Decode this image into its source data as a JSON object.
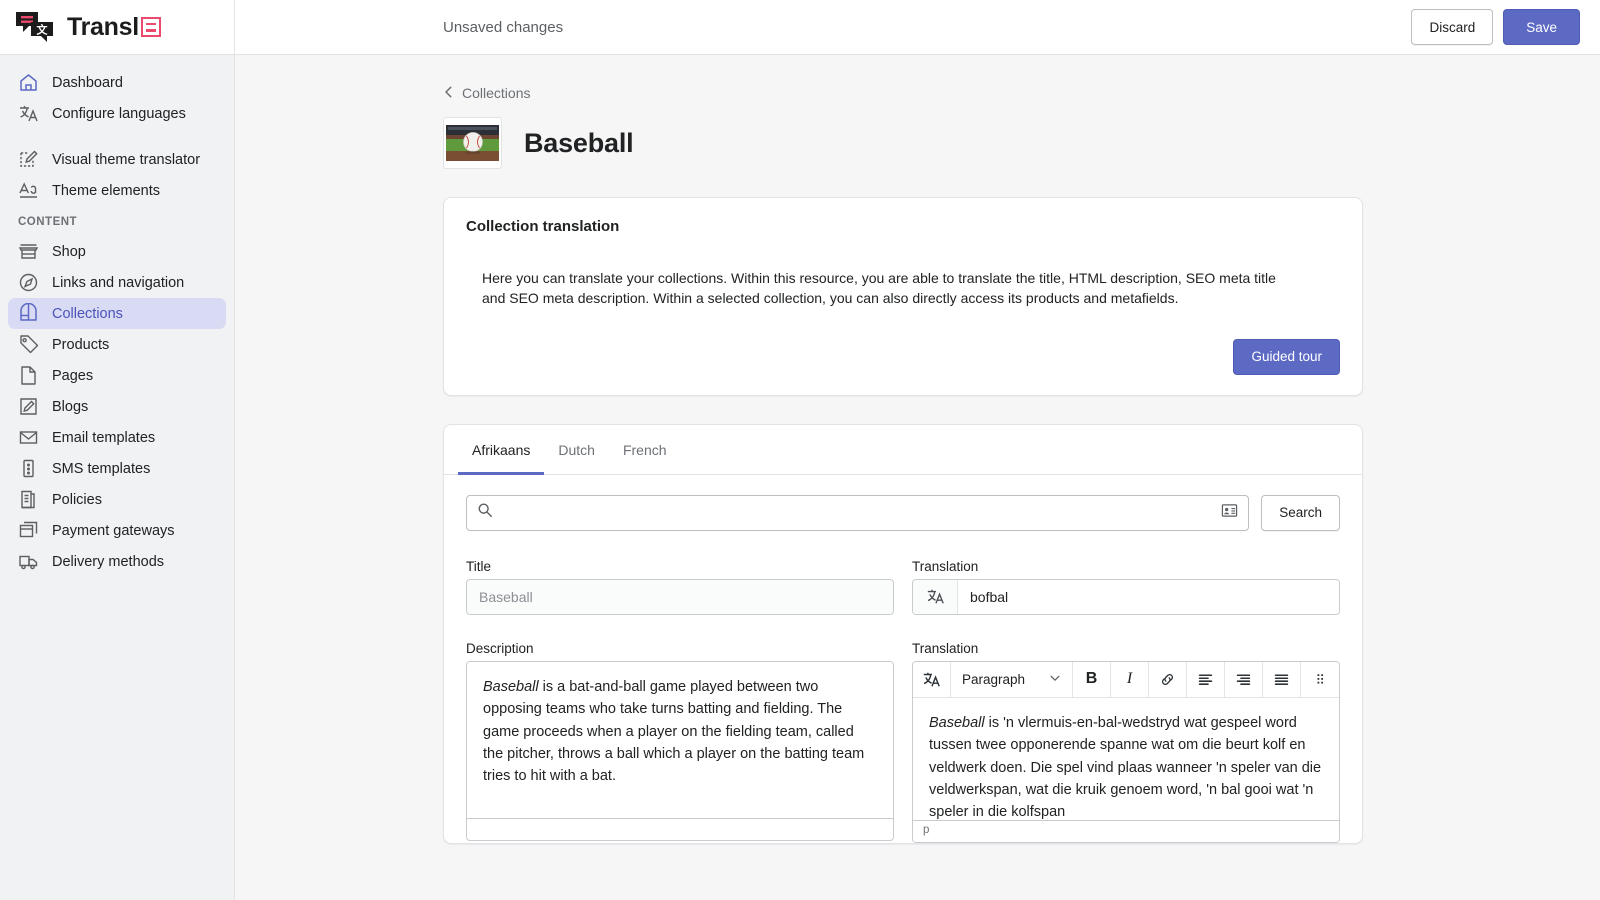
{
  "brand": {
    "name": "Transl",
    "mark_icon": "brand-square-icon"
  },
  "sidebar": {
    "items": [
      {
        "label": "Dashboard",
        "icon": "home-icon",
        "active": false
      },
      {
        "label": "Configure languages",
        "icon": "translate-icon",
        "active": false
      },
      {
        "label": "Visual theme translator",
        "icon": "theme-edit-icon",
        "active": false
      },
      {
        "label": "Theme elements",
        "icon": "text-format-icon",
        "active": false
      }
    ],
    "section_label": "CONTENT",
    "content_items": [
      {
        "label": "Shop",
        "icon": "store-icon",
        "active": false
      },
      {
        "label": "Links and navigation",
        "icon": "compass-icon",
        "active": false
      },
      {
        "label": "Collections",
        "icon": "collection-icon",
        "active": true
      },
      {
        "label": "Products",
        "icon": "tag-icon",
        "active": false
      },
      {
        "label": "Pages",
        "icon": "page-icon",
        "active": false
      },
      {
        "label": "Blogs",
        "icon": "pencil-square-icon",
        "active": false
      },
      {
        "label": "Email templates",
        "icon": "envelope-icon",
        "active": false
      },
      {
        "label": "SMS templates",
        "icon": "phone-icon",
        "active": false
      },
      {
        "label": "Policies",
        "icon": "document-list-icon",
        "active": false
      },
      {
        "label": "Payment gateways",
        "icon": "cards-icon",
        "active": false
      },
      {
        "label": "Delivery methods",
        "icon": "truck-icon",
        "active": false
      }
    ]
  },
  "topbar": {
    "unsaved_text": "Unsaved changes",
    "discard_label": "Discard",
    "save_label": "Save",
    "save_color": "#5c6ac4"
  },
  "page": {
    "breadcrumb_label": "Collections",
    "breadcrumb_icon": "chevron-left-icon",
    "title": "Baseball",
    "thumbnail_icon": "baseball-thumbnail"
  },
  "info_card": {
    "heading": "Collection translation",
    "body": "Here you can translate your collections. Within this resource, you are able to translate the title, HTML description, SEO meta title and SEO meta description. Within a selected collection, you can also directly access its products and metafields.",
    "tour_label": "Guided tour",
    "tour_color": "#5c6ac4"
  },
  "tabs": [
    {
      "label": "Afrikaans",
      "active": true
    },
    {
      "label": "Dutch",
      "active": false
    },
    {
      "label": "French",
      "active": false
    }
  ],
  "search": {
    "value": "",
    "placeholder": "",
    "icon": "search-icon",
    "trailing_icon": "contact-card-icon",
    "button_label": "Search"
  },
  "fields": {
    "title_label": "Title",
    "title_value": "Baseball",
    "title_translation_label": "Translation",
    "title_translation_value": "bofbal",
    "title_translation_icon": "translate-icon",
    "description_label": "Description",
    "description_value_lead": "Baseball",
    "description_value_rest": " is a bat-and-ball game played between two opposing teams who take turns batting and fielding. The game proceeds when a player on the fielding team, called the pitcher, throws a ball which a player on the batting team tries to hit with a bat.",
    "description_translation_label": "Translation",
    "description_translation_lead": "Baseball",
    "description_translation_rest": " is 'n vlermuis-en-bal-wedstryd wat gespeel word tussen twee opponerende spanne wat om die beurt kolf en veldwerk doen. Die spel vind plaas wanneer 'n speler van die veldwerkspan, wat die kruik genoem word, 'n bal gooi wat 'n speler in die kolfspan"
  },
  "editor": {
    "translate_icon": "translate-icon",
    "block_format": "Paragraph",
    "chevron_icon": "chevron-down-icon",
    "bold_label": "B",
    "italic_label": "I",
    "link_icon": "link-icon",
    "align_left_icon": "align-left-icon",
    "align_right_icon": "align-right-icon",
    "align_justify_icon": "align-justify-icon",
    "more_icon": "drag-dots-icon",
    "status_text": "p"
  }
}
